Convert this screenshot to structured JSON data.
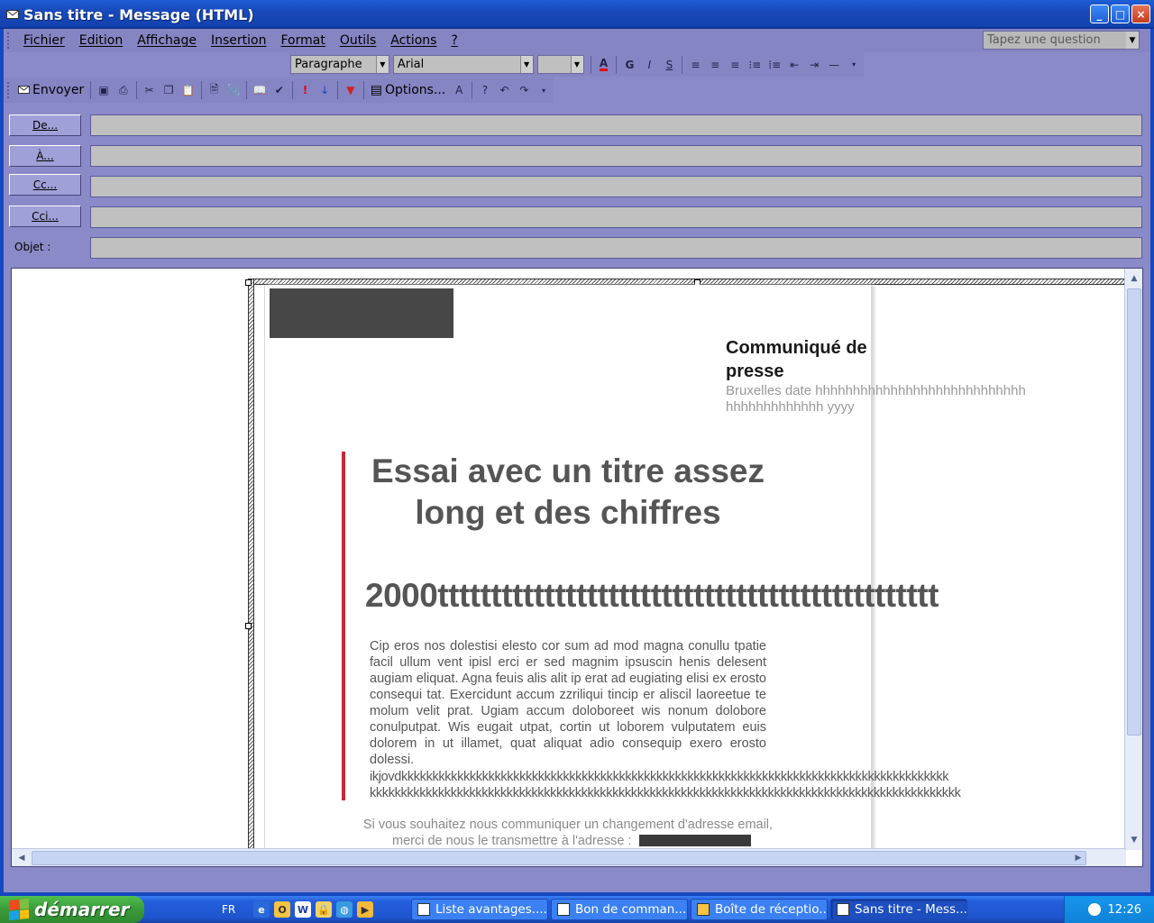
{
  "window": {
    "title": "Sans titre - Message (HTML)",
    "buttons": {
      "minimize": "_",
      "maximize": "□",
      "close": "×"
    }
  },
  "menu": {
    "items": [
      "Fichier",
      "Edition",
      "Affichage",
      "Insertion",
      "Format",
      "Outils",
      "Actions",
      "?"
    ],
    "question_placeholder": "Tapez une question"
  },
  "format_toolbar": {
    "style_value": "Paragraphe",
    "font_value": "Arial",
    "size_value": "",
    "bold": "G",
    "italic": "I",
    "underline": "S"
  },
  "standard_toolbar": {
    "send_label": "Envoyer",
    "options_label": "Options..."
  },
  "header": {
    "from_label": "De...",
    "to_label": "À...",
    "cc_label": "Cc...",
    "bcc_label": "Cci...",
    "subject_label": "Objet :",
    "from_value": "",
    "to_value": "",
    "cc_value": "",
    "bcc_value": "",
    "subject_value": ""
  },
  "message": {
    "press_title": "Communiqué de presse",
    "location_line": "Bruxelles date hhhhhhhhhhhhhhhhhhhhhhhhhhhhhhhhhhhhhhhhh yyyy",
    "headline": "Essai avec un titre assez long et des chiffres",
    "headline_cont": "2000ttttttttttttttttttttttttttttttttttttttttttttttt",
    "body": "Cip eros nos dolestisi elesto cor sum ad mod magna conullu tpatie facil ullum vent ipisl erci er sed magnim ipsuscin henis delesent augiam eliquat. Agna feuis alis alit ip erat ad eugiating elisi ex erosto consequi tat. Exercidunt accum zzriliqui tincip er aliscil laoreetue te molum velit prat. Ugiam accum doloboreet wis nonum dolobore conulputpat. Wis eugait utpat, cortin ut loborem vulputatem euis dolorem in ut illamet, quat aliquat adio consequip exero erosto dolessi.",
    "k_line_1": "ikjovdkkkkkkkkkkkkkkkkkkkkkkkkkkkkkkkkkkkkkkkkkkkkkkkkkkkkkkkkkkkkkkkkkkkkkkkkkkkkkkkkkkkkkkkk",
    "k_line_2": "kkkkkkkkkkkkkkkkkkkkkkkkkkkkkkkkkkkkkkkkkkkkkkkkkkkkkkkkkkkkkkkkkkkkkkkkkkkkkkkkkkkkkkkkkkkkkkk",
    "footer_line_1": "Si vous souhaitez nous communiquer un changement d'adresse email,",
    "footer_line_2": "merci de nous le transmettre à l'adresse :"
  },
  "taskbar": {
    "start_label": "démarrer",
    "language": "FR",
    "tasks": [
      "Liste avantages....",
      "Bon de comman...",
      "Boîte de réceptio...",
      "Sans titre - Mess..."
    ],
    "clock": "12:26"
  },
  "colors": {
    "accent_red": "#c8283c",
    "window_lavender": "#8585c4",
    "xp_blue": "#245edb"
  }
}
